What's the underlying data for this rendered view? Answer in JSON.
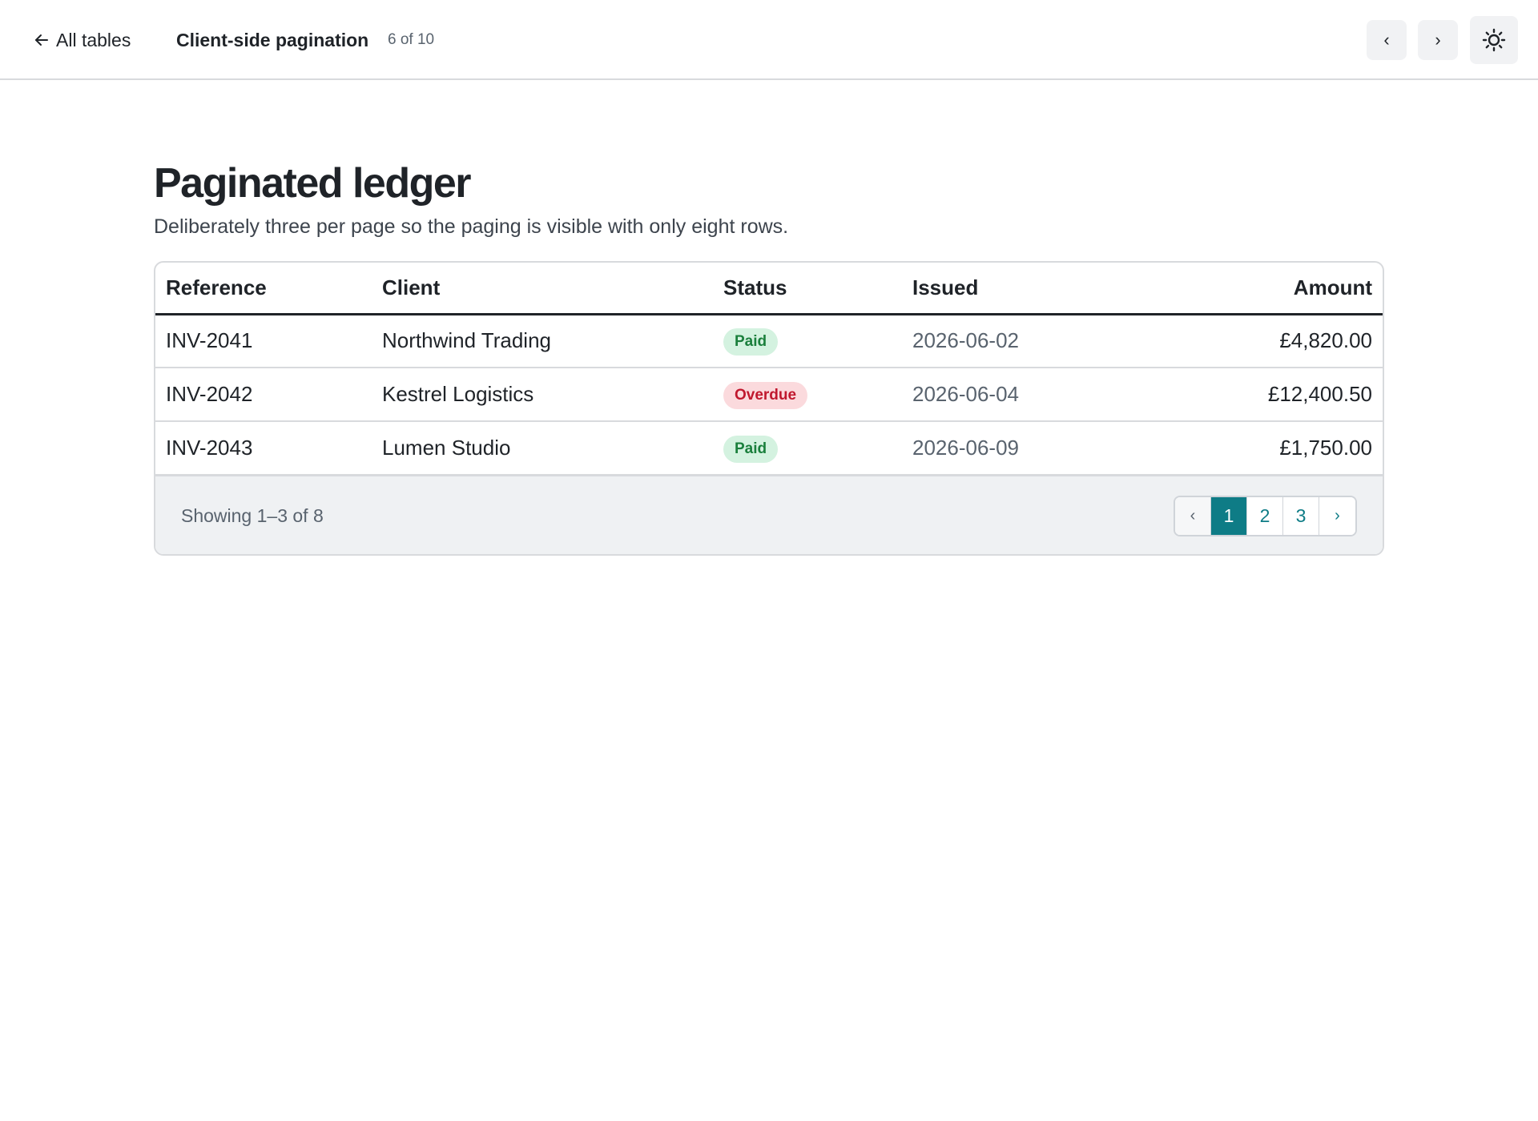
{
  "topbar": {
    "back_label": "All tables",
    "page_name": "Client-side pagination",
    "page_counter": "6 of 10",
    "prev_label": "‹",
    "next_label": "›",
    "theme_icon": "sun-icon"
  },
  "main": {
    "title": "Paginated ledger",
    "subtitle": "Deliberately three per page so the paging is visible with only eight rows."
  },
  "table": {
    "columns": [
      "Reference",
      "Client",
      "Status",
      "Issued",
      "Amount"
    ],
    "rows": [
      {
        "reference": "INV-2041",
        "client": "Northwind Trading",
        "status": "Paid",
        "issued": "2026-06-02",
        "amount": "£4,820.00"
      },
      {
        "reference": "INV-2042",
        "client": "Kestrel Logistics",
        "status": "Overdue",
        "issued": "2026-06-04",
        "amount": "£12,400.50"
      },
      {
        "reference": "INV-2043",
        "client": "Lumen Studio",
        "status": "Paid",
        "issued": "2026-06-09",
        "amount": "£1,750.00"
      }
    ],
    "footer": {
      "showing": "Showing 1–3 of 8",
      "pager": {
        "prev": "‹",
        "pages": [
          "1",
          "2",
          "3"
        ],
        "active_page": "1",
        "next": "›"
      }
    }
  },
  "colors": {
    "accent": "#0e7c86",
    "paid_bg": "#d4f2e0",
    "paid_text": "#1a7f3c",
    "overdue_bg": "#fbdadd",
    "overdue_text": "#c0182e"
  }
}
